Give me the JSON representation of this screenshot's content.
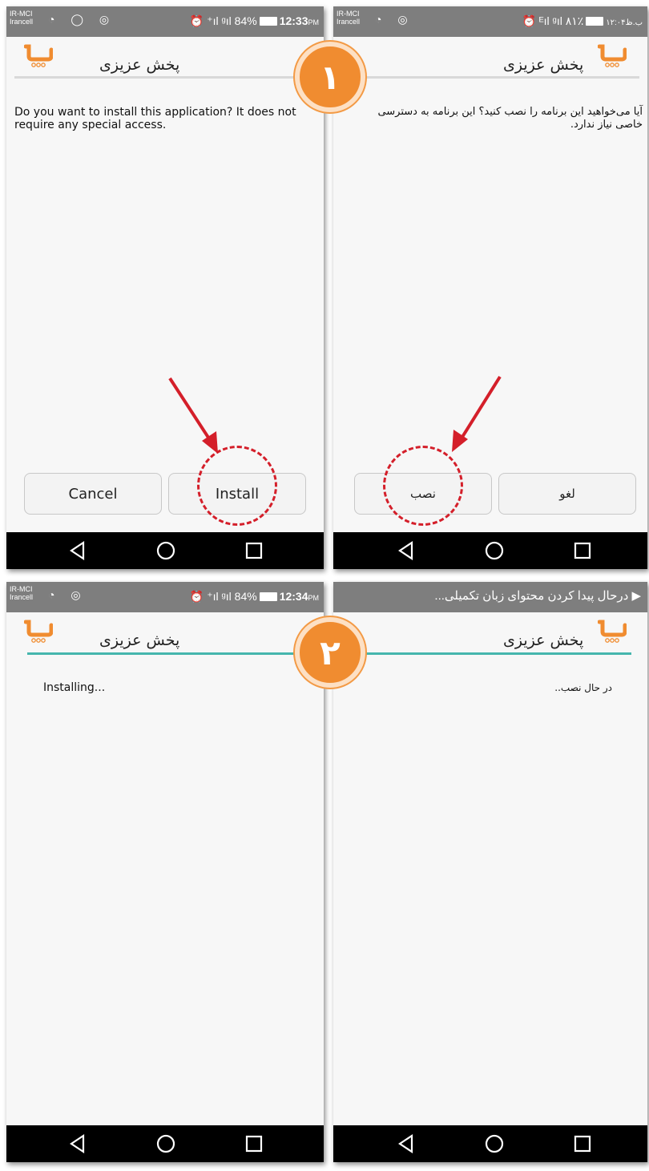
{
  "panels": {
    "top_left": {
      "status": {
        "carrier1": "IR-MCI",
        "carrier2": "Irancell",
        "right": "84%",
        "time": "12:33",
        "time_suffix": "PM"
      },
      "app_title": "پخش عزیزی",
      "message": "Do you want to install this application? It does not require any special access.",
      "cancel_label": "Cancel",
      "install_label": "Install"
    },
    "top_right": {
      "status": {
        "carrier1": "IR-MCI",
        "carrier2": "Irancell",
        "right": "۸۱٪",
        "time": "۱۲:۰۴ب.ظ"
      },
      "app_title": "پخش عزیزی",
      "message": "آیا می‌خواهید این برنامه را نصب کنید؟ این برنامه به دسترسی خاصی نیاز ندارد.",
      "install_label": "نصب",
      "cancel_label": "لغو"
    },
    "bottom_left": {
      "status": {
        "carrier1": "IR-MCI",
        "carrier2": "Irancell",
        "right": "84%",
        "time": "12:34",
        "time_suffix": "PM"
      },
      "app_title": "پخش عزیزی",
      "message": "Installing..."
    },
    "bottom_right": {
      "notification": "درحال پیدا کردن محتوای زبان تکمیلی...",
      "app_title": "پخش عزیزی",
      "message": "در حال نصب.."
    }
  },
  "badges": {
    "step1": "۱",
    "step2": "۲"
  },
  "colors": {
    "accent": "#f08c30",
    "progress": "#45b6ad",
    "highlight": "#d41f2a",
    "statusbar": "#7e7e7e"
  },
  "icons": {
    "nav": [
      "back-icon",
      "home-icon",
      "recents-icon"
    ],
    "logo": "cart-logo-icon"
  }
}
